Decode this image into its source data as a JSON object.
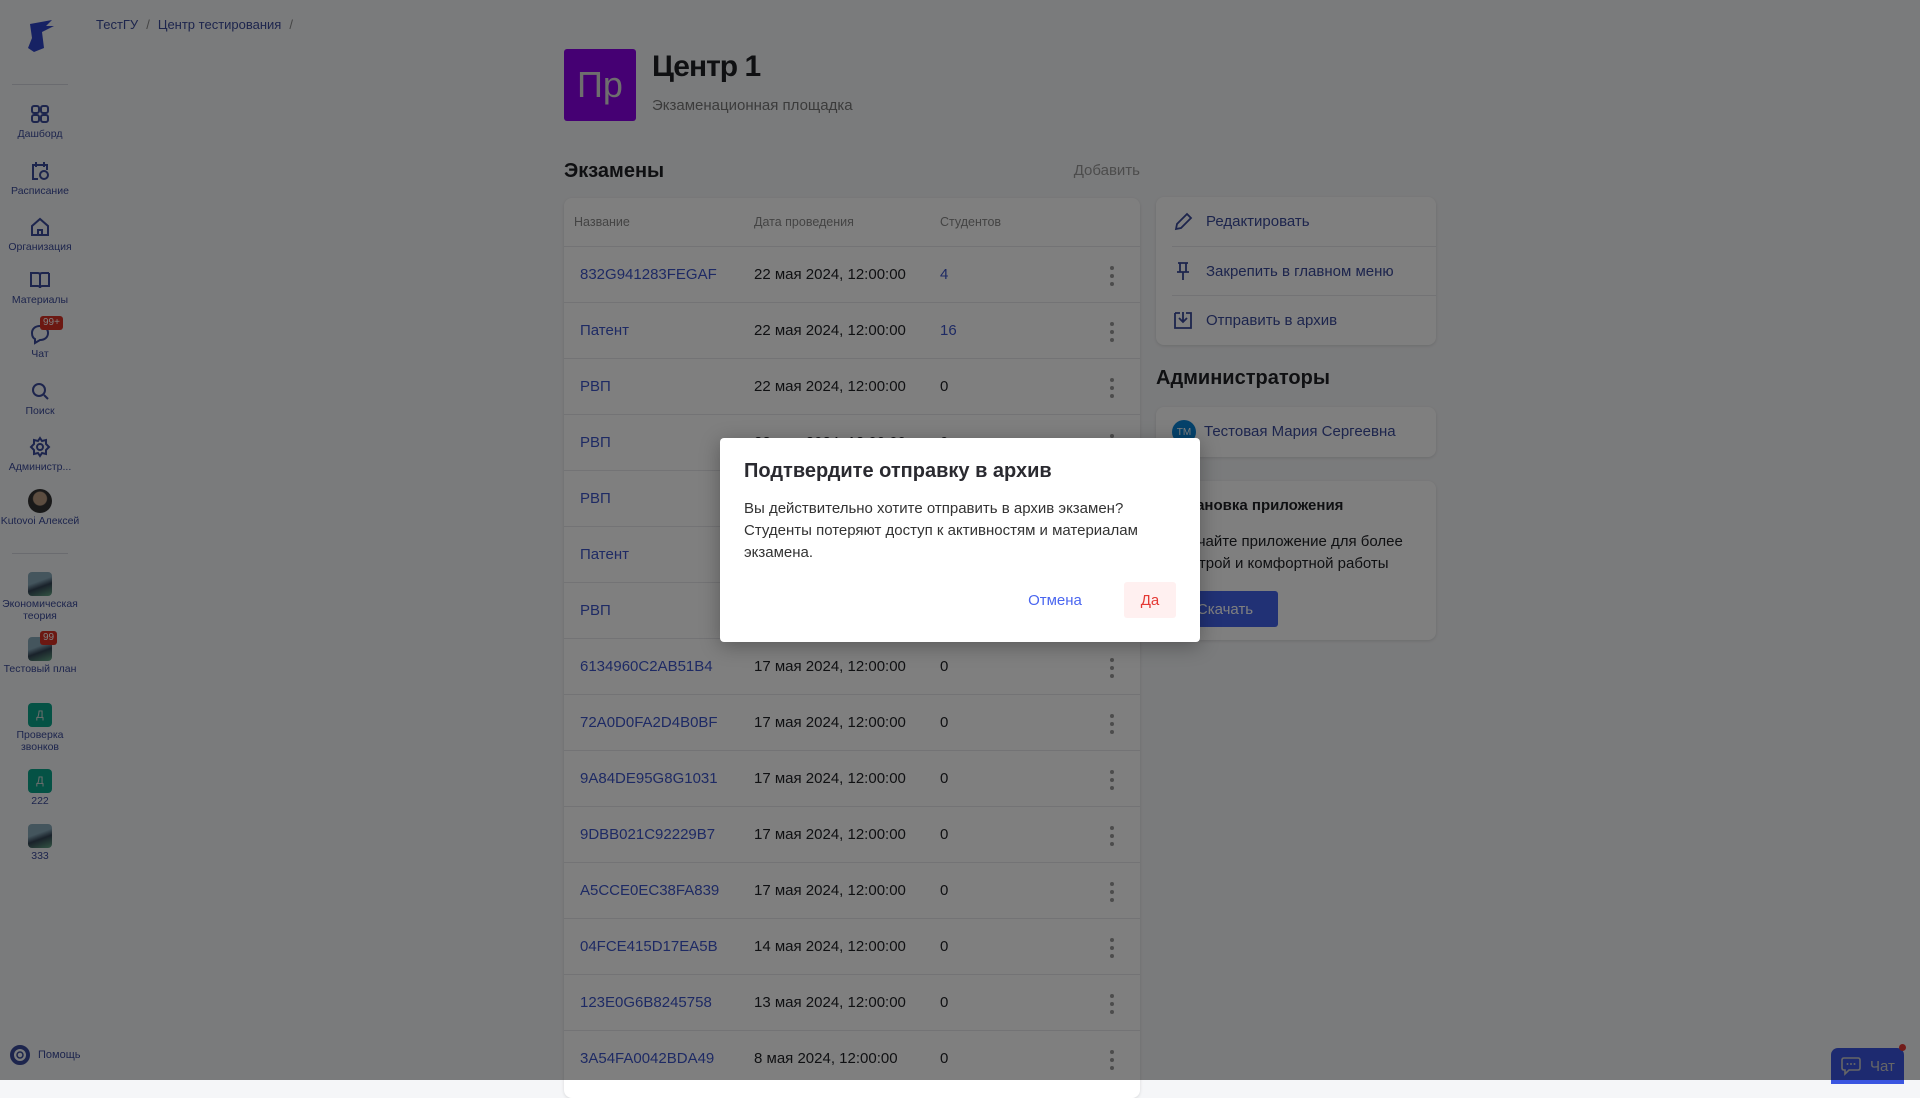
{
  "breadcrumbs": [
    "ТестГУ",
    "Центр тестирования"
  ],
  "sidebar": {
    "nav": [
      {
        "label": "Дашборд",
        "icon": "dashboard-icon"
      },
      {
        "label": "Расписание",
        "icon": "calendar-clock-icon"
      },
      {
        "label": "Организация",
        "icon": "home-icon"
      },
      {
        "label": "Материалы",
        "icon": "book-icon"
      },
      {
        "label": "Чат",
        "icon": "chat-icon",
        "badge": "99+"
      },
      {
        "label": "Поиск",
        "icon": "search-icon"
      },
      {
        "label": "Администр...",
        "icon": "gear-icon"
      },
      {
        "label": "Kutovoi Алексей",
        "icon": "user-avatar"
      }
    ],
    "courses": [
      {
        "label": "Экономическая теория",
        "thumb": "photo"
      },
      {
        "label": "Тестовый план",
        "thumb": "photo",
        "badge": "99"
      },
      {
        "label": "Проверка звонков",
        "thumb": "letter",
        "letter": "Д"
      },
      {
        "label": "222",
        "thumb": "letter",
        "letter": "Д"
      },
      {
        "label": "333",
        "thumb": "photo"
      }
    ],
    "help": "Помощь"
  },
  "header": {
    "avatar": "Пр",
    "title": "Центр 1",
    "subtitle": "Экзаменационная площадка",
    "avatar_color": "#8a00e6"
  },
  "exams": {
    "title": "Экзамены",
    "add": "Добавить",
    "columns": [
      "Название",
      "Дата проведения",
      "Студентов"
    ],
    "rows": [
      {
        "name": "832G941283FEGAF",
        "date": "22 мая 2024, 12:00:00",
        "students": "4"
      },
      {
        "name": "Патент",
        "date": "22 мая 2024, 12:00:00",
        "students": "16"
      },
      {
        "name": "РВП",
        "date": "22 мая 2024, 12:00:00",
        "students": "0"
      },
      {
        "name": "РВП",
        "date": "22 мая 2024, 12:00:00",
        "students": "0"
      },
      {
        "name": "РВП",
        "date": "",
        "students": ""
      },
      {
        "name": "Патент",
        "date": "",
        "students": ""
      },
      {
        "name": "РВП",
        "date": "",
        "students": ""
      },
      {
        "name": "6134960C2AB51B4",
        "date": "17 мая 2024, 12:00:00",
        "students": "0"
      },
      {
        "name": "72A0D0FA2D4B0BF",
        "date": "17 мая 2024, 12:00:00",
        "students": "0"
      },
      {
        "name": "9A84DE95G8G1031",
        "date": "17 мая 2024, 12:00:00",
        "students": "0"
      },
      {
        "name": "9DBB021C92229B7",
        "date": "17 мая 2024, 12:00:00",
        "students": "0"
      },
      {
        "name": "A5CCE0EC38FA839",
        "date": "17 мая 2024, 12:00:00",
        "students": "0"
      },
      {
        "name": "04FCE415D17EA5B",
        "date": "14 мая 2024, 12:00:00",
        "students": "0"
      },
      {
        "name": "123E0G6B8245758",
        "date": "13 мая 2024, 12:00:00",
        "students": "0"
      },
      {
        "name": "3A54FA0042BDA49",
        "date": "8 мая 2024, 12:00:00",
        "students": "0"
      }
    ]
  },
  "actions": [
    "Редактировать",
    "Закрепить в главном меню",
    "Отправить в архив"
  ],
  "admins": {
    "title": "Администраторы",
    "items": [
      {
        "initials": "ТМ",
        "name": "Тестовая Мария Сергеевна"
      }
    ]
  },
  "install": {
    "title": "Установка приложения",
    "text": "Скачайте приложение для более быстрой и комфортной работы",
    "button": "Скачать"
  },
  "modal": {
    "title": "Подтвердите отправку в архив",
    "text": "Вы действительно хотите отправить в архив экзамен? Студенты потеряют доступ к активностям и материалам экзамена.",
    "cancel": "Отмена",
    "confirm": "Да"
  },
  "chat_button": "Чат"
}
